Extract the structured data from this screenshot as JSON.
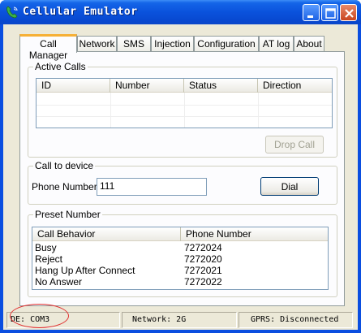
{
  "window": {
    "title": "Cellular Emulator",
    "controls": [
      "minimize",
      "maximize",
      "close"
    ]
  },
  "tabs": [
    {
      "label": "Call Manager",
      "active": true
    },
    {
      "label": "Network",
      "active": false
    },
    {
      "label": "SMS",
      "active": false
    },
    {
      "label": "Injection",
      "active": false
    },
    {
      "label": "Configuration",
      "active": false
    },
    {
      "label": "AT log",
      "active": false
    },
    {
      "label": "About",
      "active": false
    }
  ],
  "active_calls": {
    "title": "Active Calls",
    "columns": [
      "ID",
      "Number",
      "Status",
      "Direction"
    ],
    "rows": [],
    "drop_button": "Drop Call"
  },
  "call_to_device": {
    "title": "Call to device",
    "phone_label": "Phone Number:",
    "phone_value": "111",
    "dial_button": "Dial"
  },
  "preset": {
    "title": "Preset Number",
    "columns": [
      "Call Behavior",
      "Phone Number"
    ],
    "rows": [
      {
        "behavior": "Busy",
        "number": "7272024"
      },
      {
        "behavior": "Reject",
        "number": "7272020"
      },
      {
        "behavior": "Hang Up After Connect",
        "number": "7272021"
      },
      {
        "behavior": "No Answer",
        "number": "7272022"
      }
    ]
  },
  "status": {
    "port": "DE: COM3",
    "network": "Network: 2G",
    "gprs": "GPRS: Disconnected"
  },
  "colors": {
    "titlebar": "#0a52dc",
    "tab_highlight": "#f6b035",
    "annotation_oval": "#e03030"
  }
}
